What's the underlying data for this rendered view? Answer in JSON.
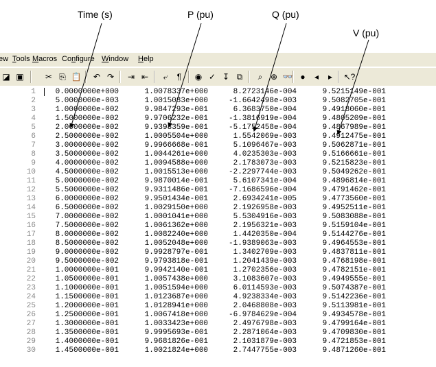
{
  "annotations": {
    "time": "Time (s)",
    "p": "P (pu)",
    "q": "Q (pu)",
    "v": "V (pu)"
  },
  "menu": [
    {
      "label": "ew",
      "u": ""
    },
    {
      "label": "Tools",
      "u": "T"
    },
    {
      "label": "Macros",
      "u": "M"
    },
    {
      "label": "Configure",
      "u": "n"
    },
    {
      "label": "Window",
      "u": "W"
    },
    {
      "label": "Help",
      "u": "H"
    }
  ],
  "toolbar_icons": [
    "print-preview-icon",
    "sidebar-icon",
    "cut-icon",
    "copy-icon",
    "paste-icon",
    "undo-icon",
    "redo-icon",
    "indent-icon",
    "outdent-icon",
    "word-wrap-icon",
    "pilcrow-icon",
    "globe-icon",
    "spell-check-icon",
    "sort-icon",
    "compare-icon",
    "find-icon",
    "find-in-files-icon",
    "binoculars-icon",
    "bookmark-icon",
    "previous-bookmark-icon",
    "next-bookmark-icon",
    "help-pointer-icon"
  ],
  "toolbar_glyphs": [
    "◪",
    "▣",
    "✂",
    "⎘",
    "📋",
    "↶",
    "↷",
    "⇥",
    "⇤",
    "⤶",
    "¶",
    "◉",
    "✓",
    "↧",
    "⧉",
    "⌕",
    "⊕",
    "👓",
    "●",
    "◂",
    "▸",
    "↖?"
  ],
  "rows": [
    [
      "1",
      "0.0000000e+000",
      "1.0078337e+000",
      "8.2723146e-004",
      "9.5215149e-001"
    ],
    [
      "2",
      "5.0000000e-003",
      "1.0015083e+000",
      "-1.6642498e-003",
      "9.5082705e-001"
    ],
    [
      "3",
      "1.0000000e-002",
      "9.9847293e-001",
      "6.3683750e-004",
      "9.4918060e-001"
    ],
    [
      "4",
      "1.5000000e-002",
      "9.9706232e-001",
      "-1.3816919e-004",
      "9.4805209e-001"
    ],
    [
      "5",
      "2.0000000e-002",
      "9.9398359e-001",
      "-5.1752458e-004",
      "9.4867989e-001"
    ],
    [
      "6",
      "2.5000000e-002",
      "1.0005504e+000",
      "1.5542069e-003",
      "9.4912475e-001"
    ],
    [
      "7",
      "3.0000000e-002",
      "9.9966668e-001",
      "5.1096467e-003",
      "9.5062871e-001"
    ],
    [
      "8",
      "3.5000000e-002",
      "1.0044261e+000",
      "4.0235303e-003",
      "9.5166661e-001"
    ],
    [
      "9",
      "4.0000000e-002",
      "1.0094588e+000",
      "2.1783073e-003",
      "9.5215823e-001"
    ],
    [
      "10",
      "4.5000000e-002",
      "1.0015513e+000",
      "-2.2297744e-003",
      "9.5049262e-001"
    ],
    [
      "11",
      "5.0000000e-002",
      "9.9870014e-001",
      "5.6107341e-004",
      "9.4896814e-001"
    ],
    [
      "12",
      "5.5000000e-002",
      "9.9311486e-001",
      "-7.1686596e-004",
      "9.4791462e-001"
    ],
    [
      "13",
      "6.0000000e-002",
      "9.9501434e-001",
      "2.6934241e-005",
      "9.4773560e-001"
    ],
    [
      "14",
      "6.5000000e-002",
      "1.0029150e+000",
      "2.1926958e-003",
      "9.4952511e-001"
    ],
    [
      "15",
      "7.0000000e-002",
      "1.0001041e+000",
      "5.5304916e-003",
      "9.5083088e-001"
    ],
    [
      "16",
      "7.5000000e-002",
      "1.0061362e+000",
      "2.1956321e-003",
      "9.5159104e-001"
    ],
    [
      "17",
      "8.0000000e-002",
      "1.0082240e+000",
      "1.4420350e-004",
      "9.5144276e-001"
    ],
    [
      "18",
      "8.5000000e-002",
      "1.0052048e+000",
      "-1.9389063e-003",
      "9.4964553e-001"
    ],
    [
      "19",
      "9.0000000e-002",
      "9.9928797e-001",
      "1.3402709e-003",
      "9.4837811e-001"
    ],
    [
      "20",
      "9.5000000e-002",
      "9.9793818e-001",
      "1.2041439e-003",
      "9.4768198e-001"
    ],
    [
      "21",
      "1.0000000e-001",
      "9.9942140e-001",
      "1.2702356e-003",
      "9.4782151e-001"
    ],
    [
      "22",
      "1.0500000e-001",
      "1.0057438e+000",
      "3.1083607e-003",
      "9.4949555e-001"
    ],
    [
      "23",
      "1.1000000e-001",
      "1.0051594e+000",
      "6.0114593e-003",
      "9.5074387e-001"
    ],
    [
      "24",
      "1.1500000e-001",
      "1.0123687e+000",
      "4.9238334e-003",
      "9.5142236e-001"
    ],
    [
      "25",
      "1.2000000e-001",
      "1.0128941e+000",
      "2.0468808e-003",
      "9.5113981e-001"
    ],
    [
      "26",
      "1.2500000e-001",
      "1.0067418e+000",
      "-6.9784629e-004",
      "9.4934578e-001"
    ],
    [
      "27",
      "1.3000000e-001",
      "1.0033423e+000",
      "2.4976798e-003",
      "9.4799164e-001"
    ],
    [
      "28",
      "1.3500000e-001",
      "9.9995693e-001",
      "2.2871064e-003",
      "9.4709830e-001"
    ],
    [
      "29",
      "1.4000000e-001",
      "9.9681826e-001",
      "2.1031879e-003",
      "9.4721853e-001"
    ],
    [
      "30",
      "1.4500000e-001",
      "1.0021824e+000",
      "2.7447755e-003",
      "9.4871260e-001"
    ]
  ]
}
